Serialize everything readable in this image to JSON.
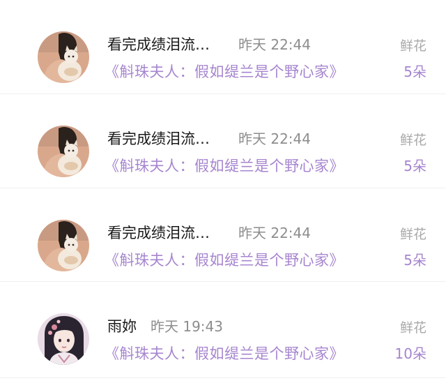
{
  "items": [
    {
      "name": "看完成绩泪流…",
      "time": "昨天 22:44",
      "title": "《斛珠夫人：假如缇兰是个野心家》",
      "gift_label": "鲜花",
      "gift_count": "5朵",
      "avatar": "woman-with-cat-avatar"
    },
    {
      "name": "看完成绩泪流…",
      "time": "昨天 22:44",
      "title": "《斛珠夫人：假如缇兰是个野心家》",
      "gift_label": "鲜花",
      "gift_count": "5朵",
      "avatar": "woman-with-cat-avatar"
    },
    {
      "name": "看完成绩泪流…",
      "time": "昨天 22:44",
      "title": "《斛珠夫人：假如缇兰是个野心家》",
      "gift_label": "鲜花",
      "gift_count": "5朵",
      "avatar": "woman-with-cat-avatar"
    },
    {
      "name": "雨妳",
      "time": "昨天 19:43",
      "title": "《斛珠夫人：假如缇兰是个野心家》",
      "gift_label": "鲜花",
      "gift_count": "10朵",
      "avatar": "illustrated-girl-avatar"
    }
  ],
  "colors": {
    "accent_purple": "#a685cf",
    "name_text": "#1a1a1a",
    "time_text": "#8d8d8d",
    "gift_label_text": "#a9a9a9",
    "divider": "#f0eef2"
  }
}
